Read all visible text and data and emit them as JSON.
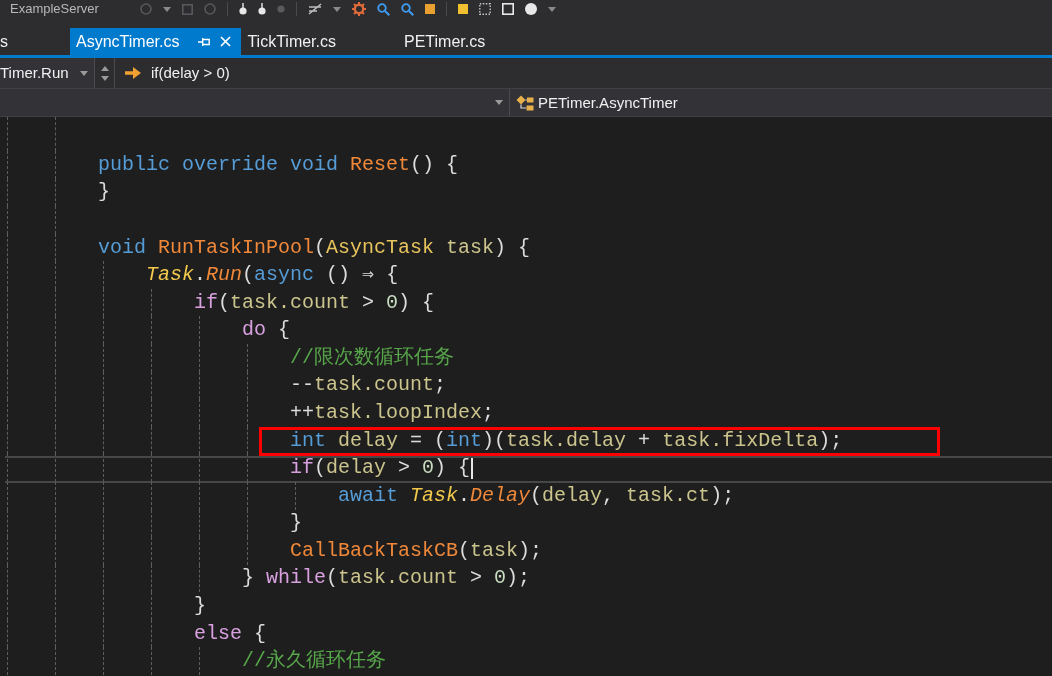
{
  "window": {
    "title": "ExampleServer"
  },
  "tabs": [
    {
      "label": "s",
      "selected": false
    },
    {
      "label": "AsyncTimer.cs",
      "selected": true
    },
    {
      "label": "TickTimer.cs",
      "selected": false
    },
    {
      "label": "PETimer.cs",
      "selected": false
    }
  ],
  "navigation_bar": {
    "member": "Timer.Run",
    "statement": "if(delay > 0)",
    "type": "PETimer.AsyncTimer"
  },
  "code": {
    "lines": [
      {
        "kind": "code",
        "tokens": [
          {
            "text": "public override void ",
            "kind": "keyword"
          },
          {
            "text": "Reset",
            "kind": "method"
          },
          {
            "text": "() {",
            "kind": "plain"
          }
        ],
        "current": false,
        "boxed": false
      },
      {
        "kind": "code",
        "tokens": [
          {
            "text": "}",
            "kind": "plain"
          }
        ],
        "current": false,
        "boxed": false
      },
      {
        "kind": "blank"
      },
      {
        "kind": "code",
        "tokens": [
          {
            "text": "void ",
            "kind": "keyword"
          },
          {
            "text": "RunTaskInPool",
            "kind": "method"
          },
          {
            "text": "(",
            "kind": "plain"
          },
          {
            "text": "AsyncTask",
            "kind": "type"
          },
          {
            "text": " task",
            "kind": "variable"
          },
          {
            "text": ") {",
            "kind": "plain"
          }
        ],
        "current": false,
        "boxed": false,
        "children": [
          {
            "kind": "code",
            "tokens": [
              {
                "text": "Task",
                "kind": "class"
              },
              {
                "text": ".",
                "kind": "plain"
              },
              {
                "text": "Run",
                "kind": "static-method"
              },
              {
                "text": "(",
                "kind": "plain"
              },
              {
                "text": "async",
                "kind": "keyword"
              },
              {
                "text": " () ⇒ {",
                "kind": "plain"
              }
            ],
            "current": false,
            "boxed": false,
            "children": [
              {
                "kind": "code",
                "tokens": [
                  {
                    "text": "if",
                    "kind": "control"
                  },
                  {
                    "text": "(",
                    "kind": "plain"
                  },
                  {
                    "text": "task.count",
                    "kind": "variable"
                  },
                  {
                    "text": " > ",
                    "kind": "plain"
                  },
                  {
                    "text": "0",
                    "kind": "number"
                  },
                  {
                    "text": ") {",
                    "kind": "plain"
                  }
                ],
                "current": false,
                "boxed": false,
                "children": [
                  {
                    "kind": "code",
                    "tokens": [
                      {
                        "text": "do",
                        "kind": "control"
                      },
                      {
                        "text": " {",
                        "kind": "plain"
                      }
                    ],
                    "current": false,
                    "boxed": false,
                    "children": [
                      {
                        "kind": "code",
                        "tokens": [
                          {
                            "text": "//限次数循环任务",
                            "kind": "comment"
                          }
                        ],
                        "current": false,
                        "boxed": false
                      },
                      {
                        "kind": "code",
                        "tokens": [
                          {
                            "text": "--",
                            "kind": "plain"
                          },
                          {
                            "text": "task.count",
                            "kind": "variable"
                          },
                          {
                            "text": ";",
                            "kind": "plain"
                          }
                        ],
                        "current": false,
                        "boxed": false
                      },
                      {
                        "kind": "code",
                        "tokens": [
                          {
                            "text": "++",
                            "kind": "plain"
                          },
                          {
                            "text": "task.loopIndex",
                            "kind": "variable"
                          },
                          {
                            "text": ";",
                            "kind": "plain"
                          }
                        ],
                        "current": false,
                        "boxed": false
                      },
                      {
                        "kind": "code",
                        "tokens": [
                          {
                            "text": "int ",
                            "kind": "keyword"
                          },
                          {
                            "text": "delay",
                            "kind": "variable"
                          },
                          {
                            "text": " = (",
                            "kind": "plain"
                          },
                          {
                            "text": "int",
                            "kind": "keyword"
                          },
                          {
                            "text": ")(",
                            "kind": "plain"
                          },
                          {
                            "text": "task.delay",
                            "kind": "variable"
                          },
                          {
                            "text": " + ",
                            "kind": "plain"
                          },
                          {
                            "text": "task.fixDelta",
                            "kind": "variable"
                          },
                          {
                            "text": ");",
                            "kind": "plain"
                          }
                        ],
                        "current": false,
                        "boxed": true
                      },
                      {
                        "kind": "code",
                        "tokens": [
                          {
                            "text": "if",
                            "kind": "control"
                          },
                          {
                            "text": "(",
                            "kind": "plain"
                          },
                          {
                            "text": "delay",
                            "kind": "variable"
                          },
                          {
                            "text": " > ",
                            "kind": "plain"
                          },
                          {
                            "text": "0",
                            "kind": "number"
                          },
                          {
                            "text": ") {",
                            "kind": "plain"
                          }
                        ],
                        "current": true,
                        "boxed": false,
                        "children": [
                          {
                            "kind": "code",
                            "tokens": [
                              {
                                "text": "await ",
                                "kind": "keyword"
                              },
                              {
                                "text": "Task",
                                "kind": "class"
                              },
                              {
                                "text": ".",
                                "kind": "plain"
                              },
                              {
                                "text": "Delay",
                                "kind": "static-method"
                              },
                              {
                                "text": "(",
                                "kind": "plain"
                              },
                              {
                                "text": "delay",
                                "kind": "variable"
                              },
                              {
                                "text": ", ",
                                "kind": "plain"
                              },
                              {
                                "text": "task.ct",
                                "kind": "variable"
                              },
                              {
                                "text": ");",
                                "kind": "plain"
                              }
                            ],
                            "current": false,
                            "boxed": false
                          }
                        ]
                      },
                      {
                        "kind": "code",
                        "tokens": [
                          {
                            "text": "}",
                            "kind": "plain"
                          }
                        ],
                        "current": false,
                        "boxed": false
                      },
                      {
                        "kind": "code",
                        "tokens": [
                          {
                            "text": "CallBackTaskCB",
                            "kind": "method"
                          },
                          {
                            "text": "(",
                            "kind": "plain"
                          },
                          {
                            "text": "task",
                            "kind": "variable"
                          },
                          {
                            "text": ");",
                            "kind": "plain"
                          }
                        ],
                        "current": false,
                        "boxed": false
                      }
                    ]
                  },
                  {
                    "kind": "code",
                    "tokens": [
                      {
                        "text": "} ",
                        "kind": "plain"
                      },
                      {
                        "text": "while",
                        "kind": "control"
                      },
                      {
                        "text": "(",
                        "kind": "plain"
                      },
                      {
                        "text": "task.count",
                        "kind": "variable"
                      },
                      {
                        "text": " > ",
                        "kind": "plain"
                      },
                      {
                        "text": "0",
                        "kind": "number"
                      },
                      {
                        "text": ");",
                        "kind": "plain"
                      }
                    ],
                    "current": false,
                    "boxed": false
                  }
                ]
              },
              {
                "kind": "code",
                "tokens": [
                  {
                    "text": "}",
                    "kind": "plain"
                  }
                ],
                "current": false,
                "boxed": false
              },
              {
                "kind": "code",
                "tokens": [
                  {
                    "text": "else",
                    "kind": "control"
                  },
                  {
                    "text": " {",
                    "kind": "plain"
                  }
                ],
                "current": false,
                "boxed": false,
                "children": [
                  {
                    "kind": "code",
                    "tokens": [
                      {
                        "text": "//永久循环任务",
                        "kind": "comment"
                      }
                    ],
                    "current": false,
                    "boxed": false
                  }
                ]
              }
            ]
          }
        ]
      }
    ]
  }
}
